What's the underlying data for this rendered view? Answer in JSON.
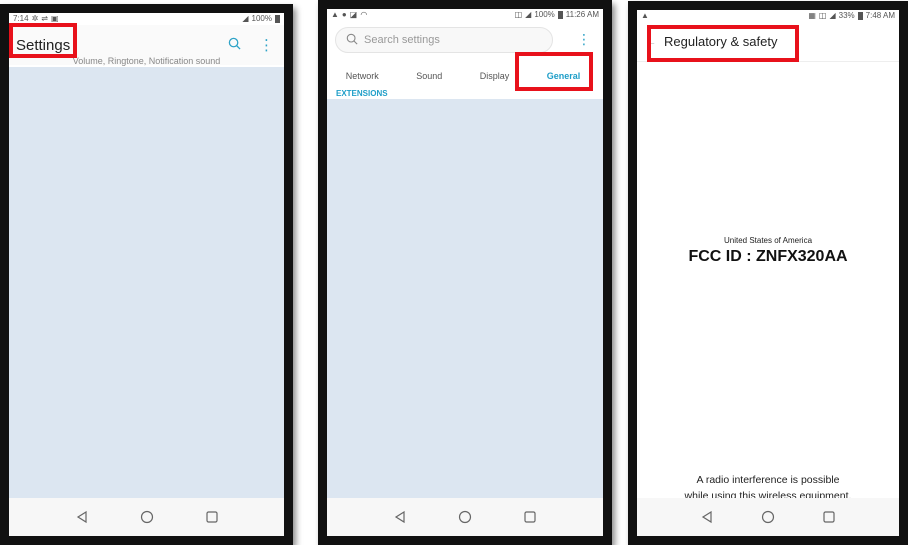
{
  "phone1": {
    "status": {
      "time": "7:14",
      "battery": "100%"
    },
    "title": "Settings",
    "subtext": "Volume, Ringtone, Notification sound",
    "icons": {
      "search": "search-icon",
      "more": "more-vert-icon"
    }
  },
  "phone2": {
    "status": {
      "time": "11:26 AM",
      "battery": "100%"
    },
    "search_placeholder": "Search settings",
    "tabs": [
      {
        "label": "Network"
      },
      {
        "label": "Sound"
      },
      {
        "label": "Display"
      },
      {
        "label": "General"
      }
    ],
    "active_tab": "General",
    "section_label": "EXTENSIONS"
  },
  "phone3": {
    "status": {
      "time": "7:48 AM",
      "battery": "33%"
    },
    "title": "Regulatory & safety",
    "country": "United States of America",
    "fcc_id": "FCC ID : ZNFX320AA",
    "notice_line1": "A radio interference is possible",
    "notice_line2": "while using this wireless equipment."
  },
  "colors": {
    "accent": "#1e9ec8",
    "highlight": "#e8111b",
    "content_bg": "#dce6f1"
  }
}
